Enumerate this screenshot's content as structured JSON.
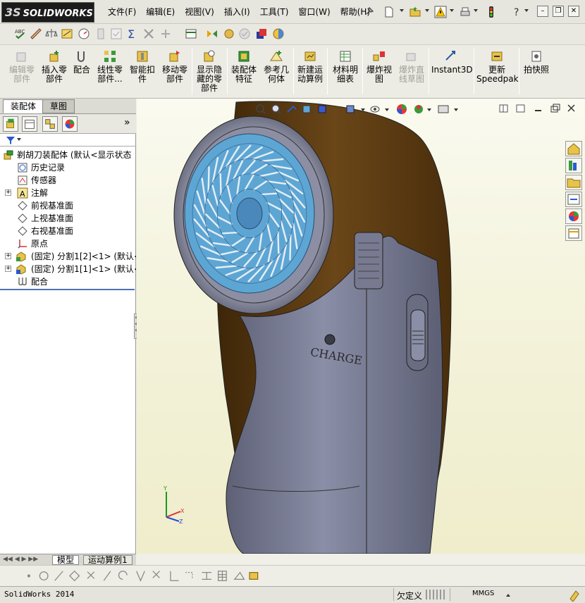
{
  "app": {
    "logo_text": "SOLIDWORKS",
    "logo_ds": "3S"
  },
  "menu": [
    "文件(F)",
    "编辑(E)",
    "视图(V)",
    "插入(I)",
    "工具(T)",
    "窗口(W)",
    "帮助(H)"
  ],
  "command_manager": [
    {
      "label": "编辑零\n部件",
      "icon": "edit-component-icon",
      "disabled": true
    },
    {
      "label": "插入零\n部件",
      "icon": "insert-component-icon",
      "disabled": false
    },
    {
      "label": "配合",
      "icon": "mate-icon",
      "disabled": false
    },
    {
      "label": "线性零\n部件...",
      "icon": "linear-pattern-icon",
      "disabled": false
    },
    {
      "label": "智能扣\n件",
      "icon": "smart-fastener-icon",
      "disabled": false
    },
    {
      "label": "移动零\n部件",
      "icon": "move-component-icon",
      "disabled": false
    },
    {
      "label": "显示隐\n藏的零\n部件",
      "icon": "show-hidden-icon",
      "disabled": false
    },
    {
      "label": "装配体\n特征",
      "icon": "assembly-feature-icon",
      "disabled": false
    },
    {
      "label": "参考几\n何体",
      "icon": "reference-geometry-icon",
      "disabled": false
    },
    {
      "label": "新建运\n动算例",
      "icon": "new-motion-study-icon",
      "disabled": false
    },
    {
      "label": "材料明\n细表",
      "icon": "bom-icon",
      "disabled": false
    },
    {
      "label": "爆炸视\n图",
      "icon": "explode-view-icon",
      "disabled": false
    },
    {
      "label": "爆炸直\n线草图",
      "icon": "explode-line-icon",
      "disabled": true
    },
    {
      "label": "Instant3D",
      "icon": "instant3d-icon",
      "disabled": false
    },
    {
      "label": "更新\nSpeedpak",
      "icon": "speedpak-icon",
      "disabled": false
    },
    {
      "label": "拍快照",
      "icon": "snapshot-icon",
      "disabled": false
    }
  ],
  "panel_tabs": {
    "assembly": "装配体",
    "sketch": "草图"
  },
  "tree": [
    {
      "label": "剃胡刀装配体  (默认<显示状态",
      "icon": "assembly-icon",
      "indent": 0,
      "expander": false
    },
    {
      "label": "历史记录",
      "icon": "history-icon",
      "indent": 1,
      "expander": false
    },
    {
      "label": "传感器",
      "icon": "sensor-icon",
      "indent": 1,
      "expander": false
    },
    {
      "label": "注解",
      "icon": "annotation-icon",
      "indent": 1,
      "expander": true
    },
    {
      "label": "前视基准面",
      "icon": "plane-icon",
      "indent": 1,
      "expander": false
    },
    {
      "label": "上视基准面",
      "icon": "plane-icon",
      "indent": 1,
      "expander": false
    },
    {
      "label": "右视基准面",
      "icon": "plane-icon",
      "indent": 1,
      "expander": false
    },
    {
      "label": "原点",
      "icon": "origin-icon",
      "indent": 1,
      "expander": false
    },
    {
      "label": "(固定) 分割1[2]<1> (默认<",
      "icon": "part-icon",
      "indent": 1,
      "expander": true
    },
    {
      "label": "(固定) 分割1[1]<1> (默认<",
      "icon": "part-icon",
      "indent": 1,
      "expander": true
    },
    {
      "label": "配合",
      "icon": "mates-folder-icon",
      "indent": 1,
      "expander": false
    }
  ],
  "bottom_tabs": {
    "model": "模型",
    "motion": "运动算例1"
  },
  "viewport": {
    "model_text": "CHARGE",
    "triad": {
      "x": "X",
      "y": "Y",
      "z": "Z"
    }
  },
  "status": {
    "app": "SolidWorks 2014",
    "state": "欠定义",
    "units": "MMGS"
  },
  "colors": {
    "body_brown": "#5a3a14",
    "body_gray": "#7a7e95",
    "mesh_blue": "#5da6d4",
    "accent_blue": "#3a6cc0"
  }
}
